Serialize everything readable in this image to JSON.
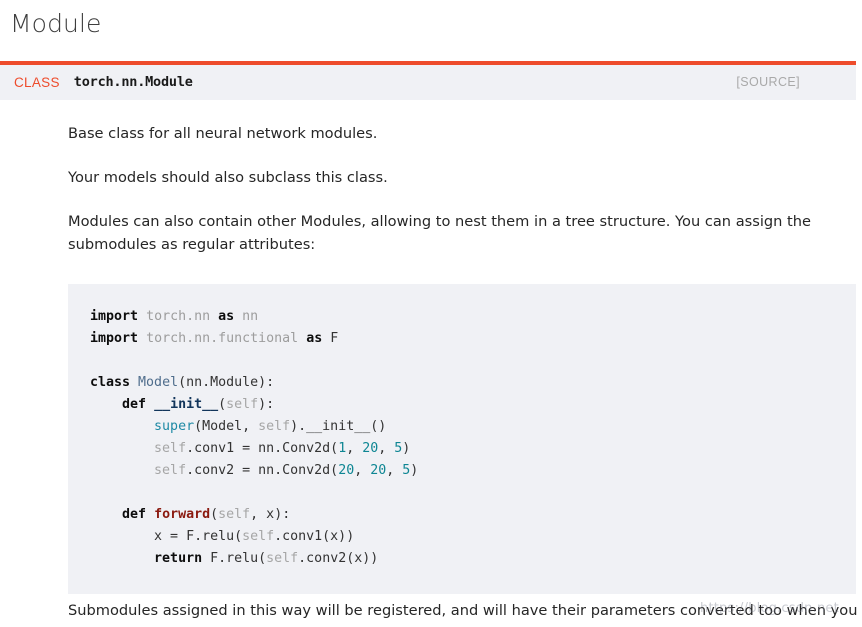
{
  "page": {
    "title": "Module"
  },
  "signature": {
    "class_keyword": "CLASS",
    "qualified_name": "torch.nn.Module",
    "source_link": "[SOURCE]",
    "accent_color": "#ee4c2c",
    "bar_background": "#f0f1f5"
  },
  "body": {
    "paragraphs": [
      "Base class for all neural network modules.",
      "Your models should also subclass this class.",
      "Modules can also contain other Modules, allowing to nest them in a tree structure. You can assign the submodules as regular attributes:"
    ],
    "trailing_paragraph": "Submodules assigned in this way will be registered, and will have their parameters converted too when you call to(), etc."
  },
  "code": {
    "language": "python",
    "background": "#f0f1f5",
    "lines": [
      [
        {
          "t": "import",
          "c": "kw"
        },
        {
          "t": " ",
          "c": "plain"
        },
        {
          "t": "torch.nn",
          "c": "dotted"
        },
        {
          "t": " ",
          "c": "plain"
        },
        {
          "t": "as",
          "c": "kw"
        },
        {
          "t": " ",
          "c": "plain"
        },
        {
          "t": "nn",
          "c": "dotted"
        }
      ],
      [
        {
          "t": "import",
          "c": "kw"
        },
        {
          "t": " ",
          "c": "plain"
        },
        {
          "t": "torch.nn.functional",
          "c": "dotted"
        },
        {
          "t": " ",
          "c": "plain"
        },
        {
          "t": "as",
          "c": "kw"
        },
        {
          "t": " ",
          "c": "plain"
        },
        {
          "t": "F",
          "c": "plain"
        }
      ],
      [],
      [
        {
          "t": "class",
          "c": "kw"
        },
        {
          "t": " ",
          "c": "plain"
        },
        {
          "t": "Model",
          "c": "cname"
        },
        {
          "t": "(nn.Module):",
          "c": "plain"
        }
      ],
      [
        {
          "t": "    ",
          "c": "plain"
        },
        {
          "t": "def",
          "c": "kw"
        },
        {
          "t": " ",
          "c": "plain"
        },
        {
          "t": "__init__",
          "c": "dunder"
        },
        {
          "t": "(",
          "c": "plain"
        },
        {
          "t": "self",
          "c": "selfv"
        },
        {
          "t": "):",
          "c": "plain"
        }
      ],
      [
        {
          "t": "        ",
          "c": "plain"
        },
        {
          "t": "super",
          "c": "bi"
        },
        {
          "t": "(Model, ",
          "c": "plain"
        },
        {
          "t": "self",
          "c": "selfv"
        },
        {
          "t": ").__init__()",
          "c": "plain"
        }
      ],
      [
        {
          "t": "        ",
          "c": "plain"
        },
        {
          "t": "self",
          "c": "selfv"
        },
        {
          "t": ".conv1 = nn.Conv2d(",
          "c": "plain"
        },
        {
          "t": "1",
          "c": "num"
        },
        {
          "t": ", ",
          "c": "plain"
        },
        {
          "t": "20",
          "c": "num"
        },
        {
          "t": ", ",
          "c": "plain"
        },
        {
          "t": "5",
          "c": "num"
        },
        {
          "t": ")",
          "c": "plain"
        }
      ],
      [
        {
          "t": "        ",
          "c": "plain"
        },
        {
          "t": "self",
          "c": "selfv"
        },
        {
          "t": ".conv2 = nn.Conv2d(",
          "c": "plain"
        },
        {
          "t": "20",
          "c": "num"
        },
        {
          "t": ", ",
          "c": "plain"
        },
        {
          "t": "20",
          "c": "num"
        },
        {
          "t": ", ",
          "c": "plain"
        },
        {
          "t": "5",
          "c": "num"
        },
        {
          "t": ")",
          "c": "plain"
        }
      ],
      [],
      [
        {
          "t": "    ",
          "c": "plain"
        },
        {
          "t": "def",
          "c": "kw"
        },
        {
          "t": " ",
          "c": "plain"
        },
        {
          "t": "forward",
          "c": "fname"
        },
        {
          "t": "(",
          "c": "plain"
        },
        {
          "t": "self",
          "c": "selfv"
        },
        {
          "t": ", x):",
          "c": "plain"
        }
      ],
      [
        {
          "t": "        x = F.relu(",
          "c": "plain"
        },
        {
          "t": "self",
          "c": "selfv"
        },
        {
          "t": ".conv1(x))",
          "c": "plain"
        }
      ],
      [
        {
          "t": "        ",
          "c": "plain"
        },
        {
          "t": "return",
          "c": "kw"
        },
        {
          "t": " F.relu(",
          "c": "plain"
        },
        {
          "t": "self",
          "c": "selfv"
        },
        {
          "t": ".conv2(x))",
          "c": "plain"
        }
      ]
    ]
  },
  "watermark": {
    "text": "https://blog.csdn.net"
  }
}
